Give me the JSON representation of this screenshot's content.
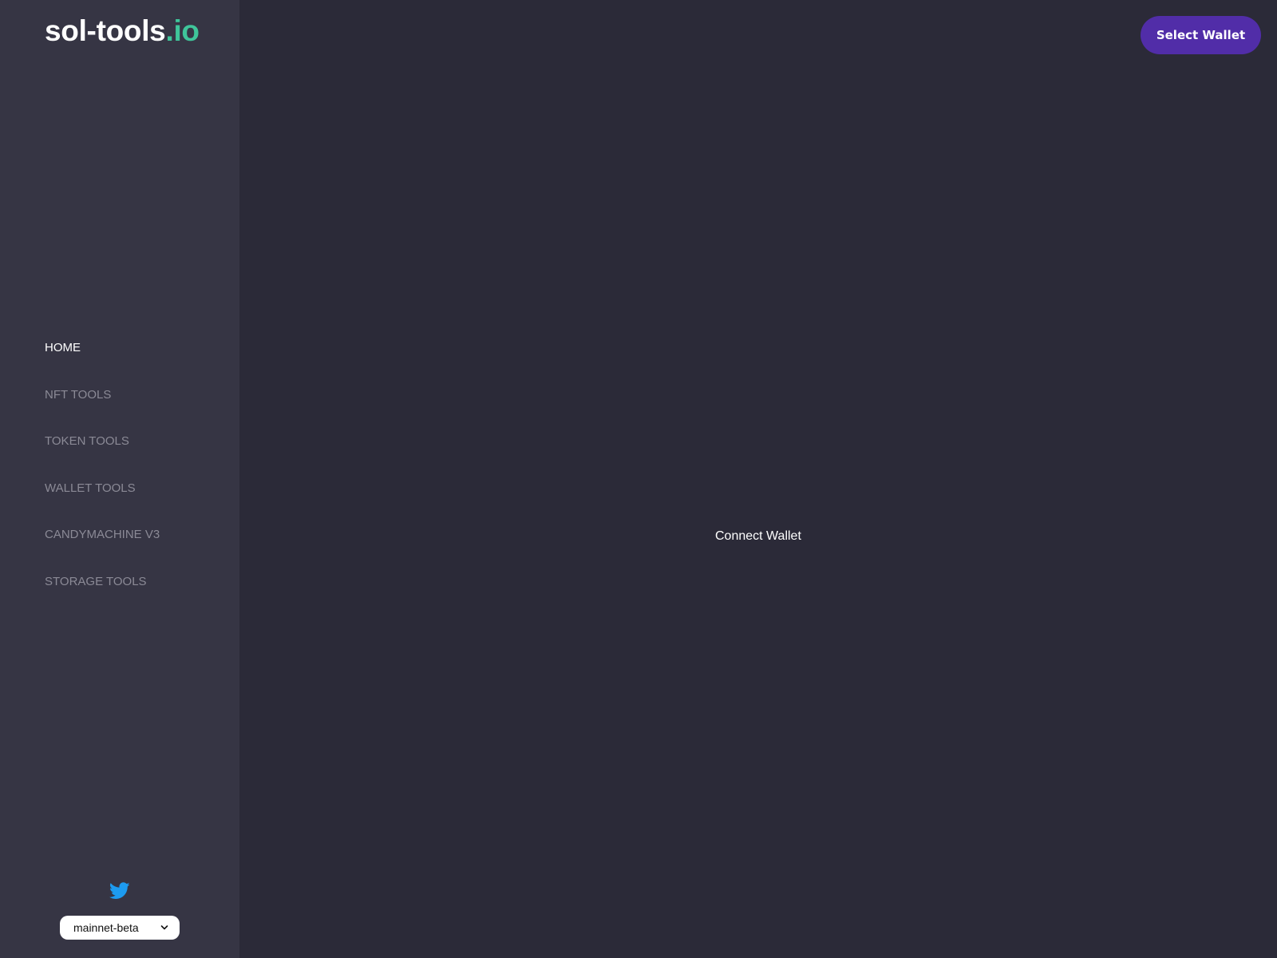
{
  "brand": {
    "name": "sol-tools",
    "tld": ".io",
    "accent_color": "#3fc59a"
  },
  "sidebar": {
    "items": [
      {
        "label": "HOME",
        "active": true
      },
      {
        "label": "NFT TOOLS",
        "active": false
      },
      {
        "label": "TOKEN TOOLS",
        "active": false
      },
      {
        "label": "WALLET TOOLS",
        "active": false
      },
      {
        "label": "CANDYMACHINE V3",
        "active": false
      },
      {
        "label": "STORAGE TOOLS",
        "active": false
      }
    ],
    "social_icon": "twitter-icon",
    "network": {
      "selected": "mainnet-beta"
    }
  },
  "header": {
    "wallet_button_label": "Select Wallet",
    "wallet_button_color": "#512da8"
  },
  "main": {
    "message": "Connect Wallet"
  },
  "colors": {
    "background": "#2b2a38",
    "sidebar": "#363544",
    "twitter": "#1d9bf0"
  }
}
